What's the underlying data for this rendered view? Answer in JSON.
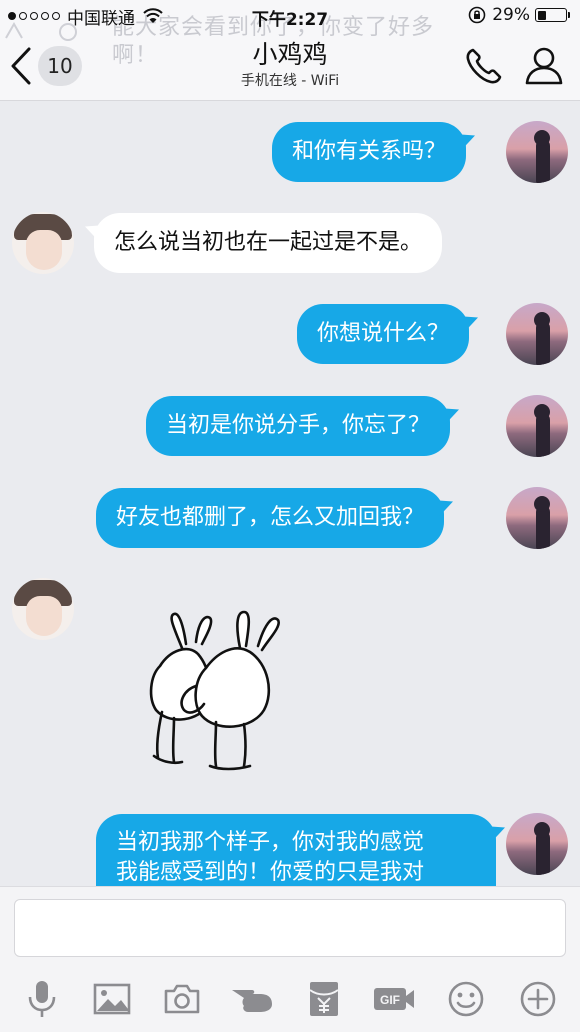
{
  "status_bar": {
    "carrier": "中国联通",
    "time": "下午2:27",
    "battery_percent": "29%",
    "battery_level": 0.29,
    "signal_bars_filled": 1,
    "signal_bars_total": 5
  },
  "header": {
    "notification_preview_line1": "能大家会看到你了，你变了好多",
    "notification_preview_line2": "啊！",
    "back_unread_count": "10",
    "title": "小鸡鸡",
    "subtitle": "手机在线 - WiFi",
    "icons": {
      "back": "chevron-left-icon",
      "call": "phone-icon",
      "profile": "person-icon"
    }
  },
  "messages": [
    {
      "sender": "me",
      "text": "和你有关系吗？"
    },
    {
      "sender": "other",
      "text": "怎么说当初也在一起过是不是。"
    },
    {
      "sender": "me",
      "text": "你想说什么？"
    },
    {
      "sender": "me",
      "text": "当初是你说分手，你忘了？"
    },
    {
      "sender": "me",
      "text": "好友也都删了，怎么又加回我？"
    },
    {
      "sender": "other",
      "type": "sticker",
      "sticker": "hugging-rabbits-sticker"
    },
    {
      "sender": "me",
      "line1": "当初我那个样子，你对我的感觉",
      "line2": "我能感受到的！你爱的只是我对"
    }
  ],
  "input": {
    "value": "",
    "placeholder": ""
  },
  "toolbar": [
    {
      "icon": "microphone-icon"
    },
    {
      "icon": "image-icon"
    },
    {
      "icon": "camera-icon"
    },
    {
      "icon": "poke-hand-icon"
    },
    {
      "icon": "red-packet-icon"
    },
    {
      "icon": "gif-icon",
      "label": "GIF"
    },
    {
      "icon": "emoji-icon"
    },
    {
      "icon": "plus-icon"
    }
  ],
  "colors": {
    "bubble_me": "#17a8e7",
    "bubble_other": "#ffffff",
    "background": "#eaebef"
  }
}
